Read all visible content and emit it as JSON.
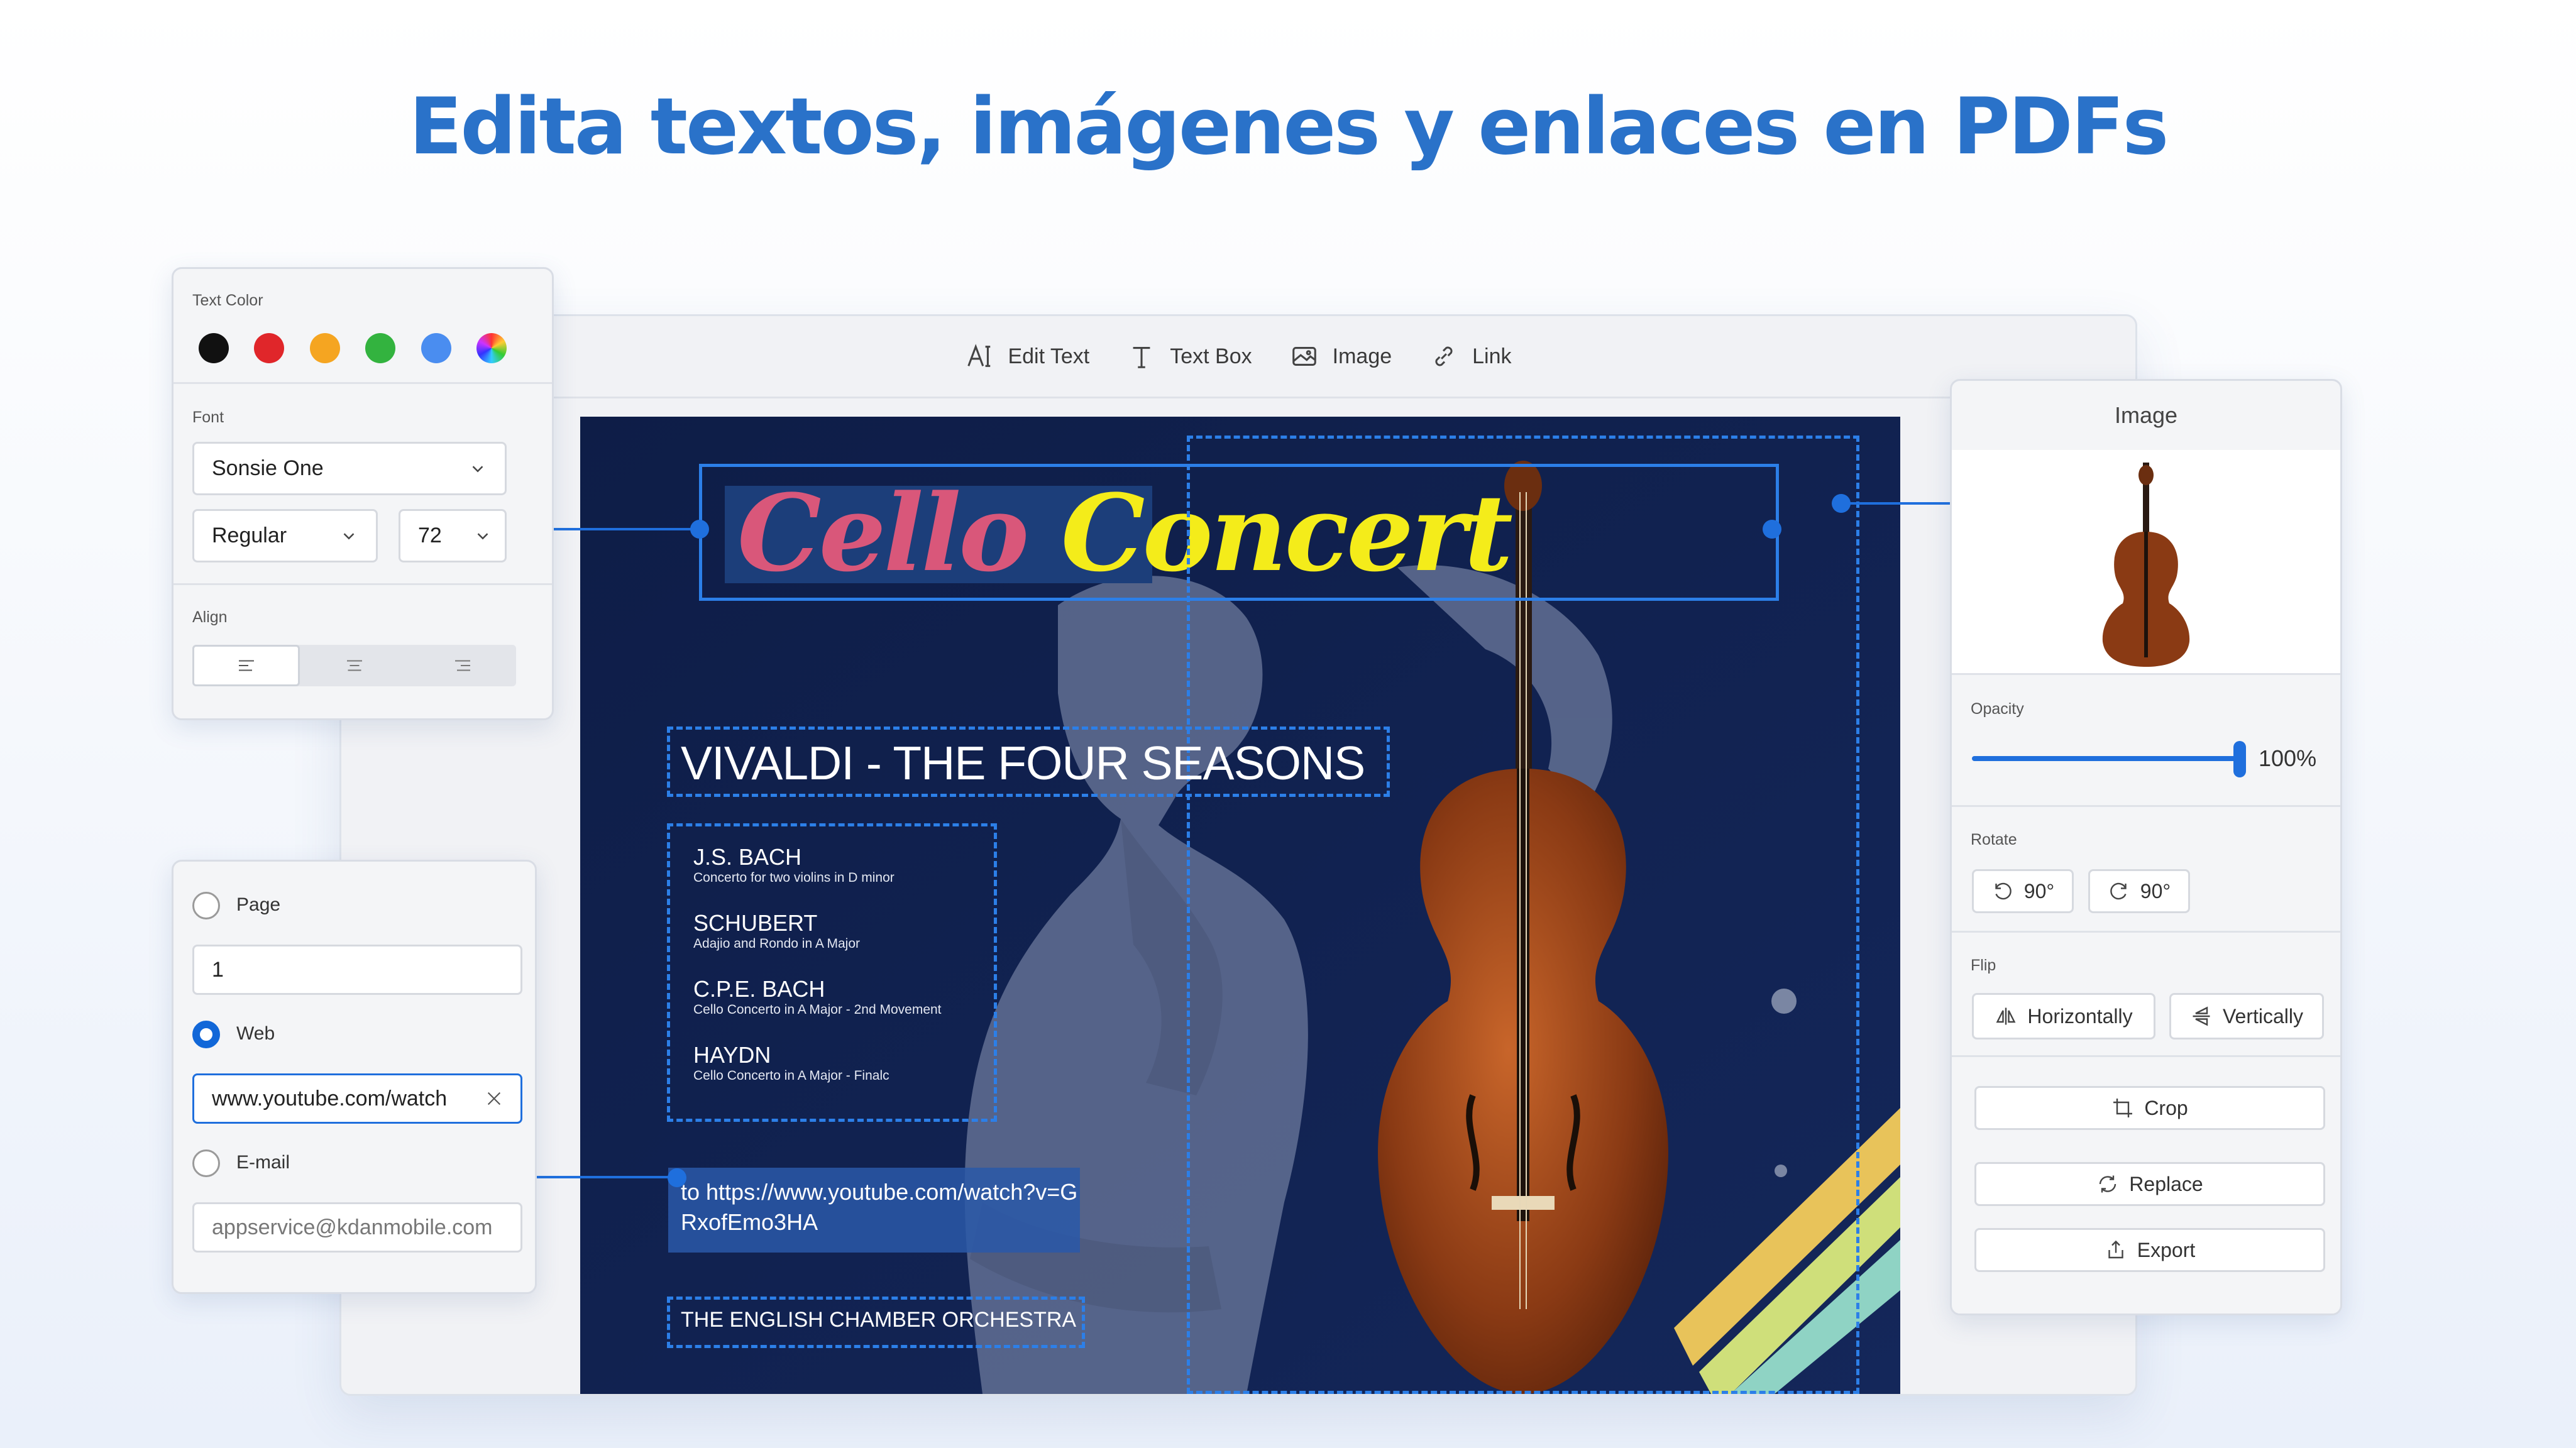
{
  "headline": "Edita textos, imágenes y enlaces en PDFs",
  "toolbar": {
    "edit_text": "Edit Text",
    "text_box": "Text Box",
    "image": "Image",
    "link": "Link"
  },
  "text_panel": {
    "text_color_label": "Text Color",
    "colors": [
      "#111111",
      "#e0262a",
      "#f5a521",
      "#33b33f",
      "#4a8df0"
    ],
    "font_label": "Font",
    "font_family": "Sonsie One",
    "font_style": "Regular",
    "font_size": "72",
    "align_label": "Align"
  },
  "link_panel": {
    "page_label": "Page",
    "page_value": "1",
    "web_label": "Web",
    "web_value": "www.youtube.com/watch",
    "email_label": "E-mail",
    "email_placeholder": "appservice@kdanmobile.com",
    "selected": "web"
  },
  "poster": {
    "title_word1": "Cello",
    "title_word2": "Concert",
    "subtitle": "VIVALDI - THE FOUR SEASONS",
    "pieces": [
      {
        "composer": "J.S. BACH",
        "work": "Concerto for two violins in D minor"
      },
      {
        "composer": "SCHUBERT",
        "work": "Adajio and Rondo in A Major"
      },
      {
        "composer": "C.P.E. BACH",
        "work": "Cello Concerto in A Major - 2nd Movement"
      },
      {
        "composer": "HAYDN",
        "work": "Cello Concerto in A Major - Finalc"
      }
    ],
    "link_text": "to https://www.youtube.com/watch?v=GRxofEmo3HA",
    "orchestra": "THE ENGLISH CHAMBER ORCHESTRA"
  },
  "image_panel": {
    "title": "Image",
    "opacity_label": "Opacity",
    "opacity_value": "100%",
    "opacity_fraction": 1.0,
    "rotate_label": "Rotate",
    "rotate_left": "90°",
    "rotate_right": "90°",
    "flip_label": "Flip",
    "flip_horizontal": "Horizontally",
    "flip_vertical": "Vertically",
    "crop": "Crop",
    "replace": "Replace",
    "export": "Export"
  },
  "accent_color": "#1f6fdd"
}
